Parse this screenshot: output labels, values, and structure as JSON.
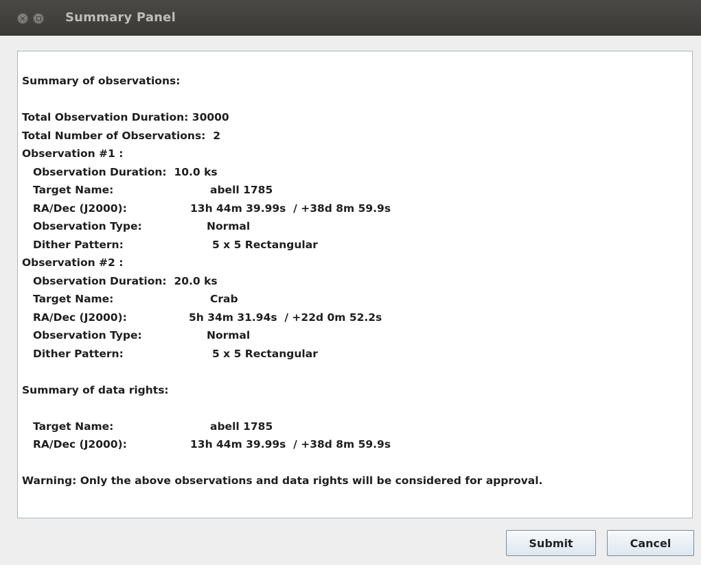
{
  "window": {
    "title": "Summary Panel",
    "close_glyph": "✕"
  },
  "summary": {
    "heading": "Summary of observations:",
    "total_duration_label": "Total Observation Duration:",
    "total_duration_value": "30000",
    "total_count_label": "Total Number of Observations:",
    "total_count_value": "2",
    "observations": [
      {
        "header": "Observation #1 :",
        "duration_label": "Observation Duration:",
        "duration_value": "10.0 ks",
        "target_label": "Target Name:",
        "target_value": "abell 1785",
        "radec_label": "RA/Dec (J2000):",
        "radec_value": "13h 44m 39.99s  / +38d 8m 59.9s",
        "type_label": "Observation Type:",
        "type_value": "Normal",
        "dither_label": "Dither Pattern:",
        "dither_value": "5 x 5 Rectangular"
      },
      {
        "header": "Observation #2 :",
        "duration_label": "Observation Duration:",
        "duration_value": "20.0 ks",
        "target_label": "Target Name:",
        "target_value": "Crab",
        "radec_label": "RA/Dec (J2000):",
        "radec_value": "5h 34m 31.94s  / +22d 0m 52.2s",
        "type_label": "Observation Type:",
        "type_value": "Normal",
        "dither_label": "Dither Pattern:",
        "dither_value": "5 x 5 Rectangular"
      }
    ],
    "rights_heading": "Summary of data rights:",
    "rights_target_label": "Target Name:",
    "rights_target_value": "abell 1785",
    "rights_radec_label": "RA/Dec (J2000):",
    "rights_radec_value": "13h 44m 39.99s  / +38d 8m 59.9s",
    "warning": "Warning: Only the above observations and data rights will be considered for approval."
  },
  "buttons": {
    "submit": "Submit",
    "cancel": "Cancel"
  }
}
